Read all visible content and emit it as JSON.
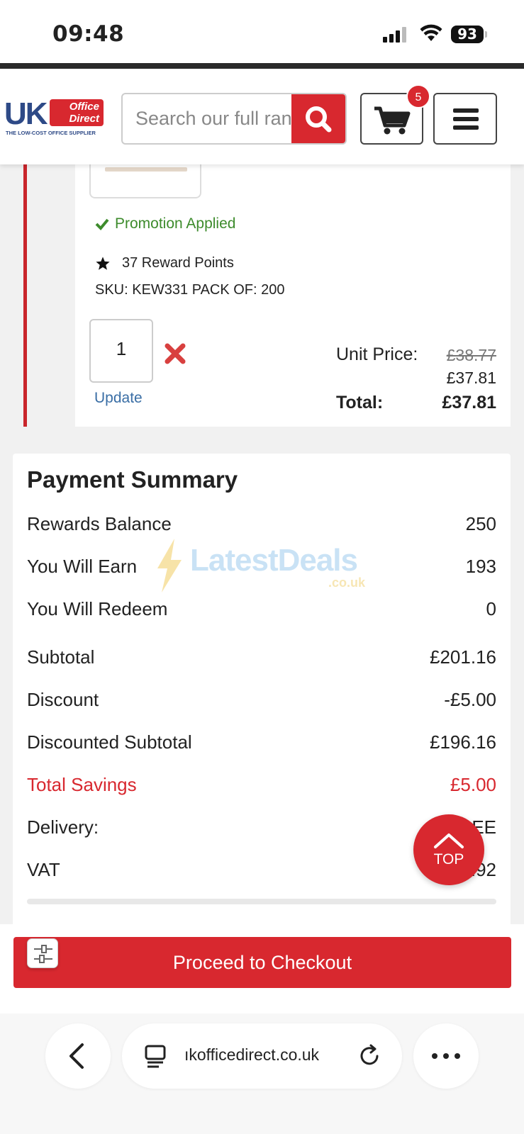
{
  "status_bar": {
    "time": "09:48",
    "battery": "93"
  },
  "header": {
    "logo": {
      "uk": "UK",
      "office_direct": "Office Direct",
      "tagline": "THE LOW-COST OFFICE SUPPLIER"
    },
    "search_placeholder": "Search our full range",
    "cart_count": "5"
  },
  "product": {
    "promotion": "Promotion Applied",
    "reward_points": "37 Reward Points",
    "sku": "SKU: KEW331 PACK OF: 200",
    "quantity": "1",
    "update_label": "Update",
    "unit_price_label": "Unit Price:",
    "unit_price_old": "£38.77",
    "unit_price_new": "£37.81",
    "total_label": "Total:",
    "total_value": "£37.81"
  },
  "payment_summary": {
    "title": "Payment Summary",
    "rows": [
      {
        "label": "Rewards Balance",
        "value": "250"
      },
      {
        "label": "You Will Earn",
        "value": "193"
      },
      {
        "label": "You Will Redeem",
        "value": "0"
      },
      {
        "label": "Subtotal",
        "value": "£201.16"
      },
      {
        "label": "Discount",
        "value": "-£5.00"
      },
      {
        "label": "Discounted Subtotal",
        "value": "£196.16"
      },
      {
        "label": "Total Savings",
        "value": "£5.00"
      },
      {
        "label": "Delivery:",
        "value": "EE"
      },
      {
        "label": "VAT",
        "value": "3.92"
      }
    ],
    "colors": {
      "savings": "#d8282f"
    }
  },
  "watermark": {
    "text": "LatestDeals",
    "suffix": ".co.uk"
  },
  "top_button": {
    "label": "TOP"
  },
  "checkout": {
    "label": "Proceed to Checkout"
  },
  "browser": {
    "url": "ıkofficedirect.co.uk"
  },
  "colors": {
    "brand_red": "#d8282f",
    "brand_blue": "#2e4a87",
    "promo_green": "#3d8b2c",
    "link_blue": "#3a6ea5"
  }
}
